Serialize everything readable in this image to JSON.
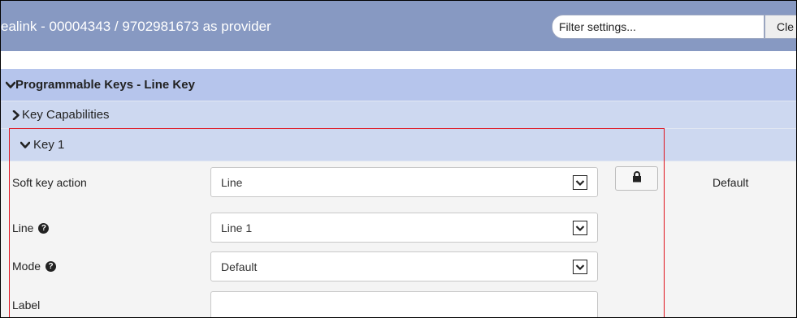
{
  "header": {
    "title": "ealink - 00004343 / 9702981673 as provider",
    "filter_placeholder": "Filter settings...",
    "clear_label": "Cle"
  },
  "sections": {
    "programmable_keys": "Programmable Keys - Line Key",
    "key_capabilities": "Key Capabilities",
    "key1": "Key 1"
  },
  "rows": {
    "soft_key_action": {
      "label": "Soft key action",
      "value": "Line",
      "status": "Default"
    },
    "line": {
      "label": "Line",
      "value": "Line 1"
    },
    "mode": {
      "label": "Mode",
      "value": "Default"
    },
    "label": {
      "label": "Label",
      "value": ""
    }
  },
  "icons": {
    "chevron_down": "chevron-down-icon",
    "chevron_right": "chevron-right-icon",
    "help": "help-icon",
    "lock": "lock-icon",
    "dropdown_arrow": "dropdown-arrow-icon"
  },
  "colors": {
    "titlebar": "#8799c2",
    "section_primary": "#b6c5ec",
    "section_secondary": "#cdd8f0",
    "highlight_border": "#e0131d"
  }
}
